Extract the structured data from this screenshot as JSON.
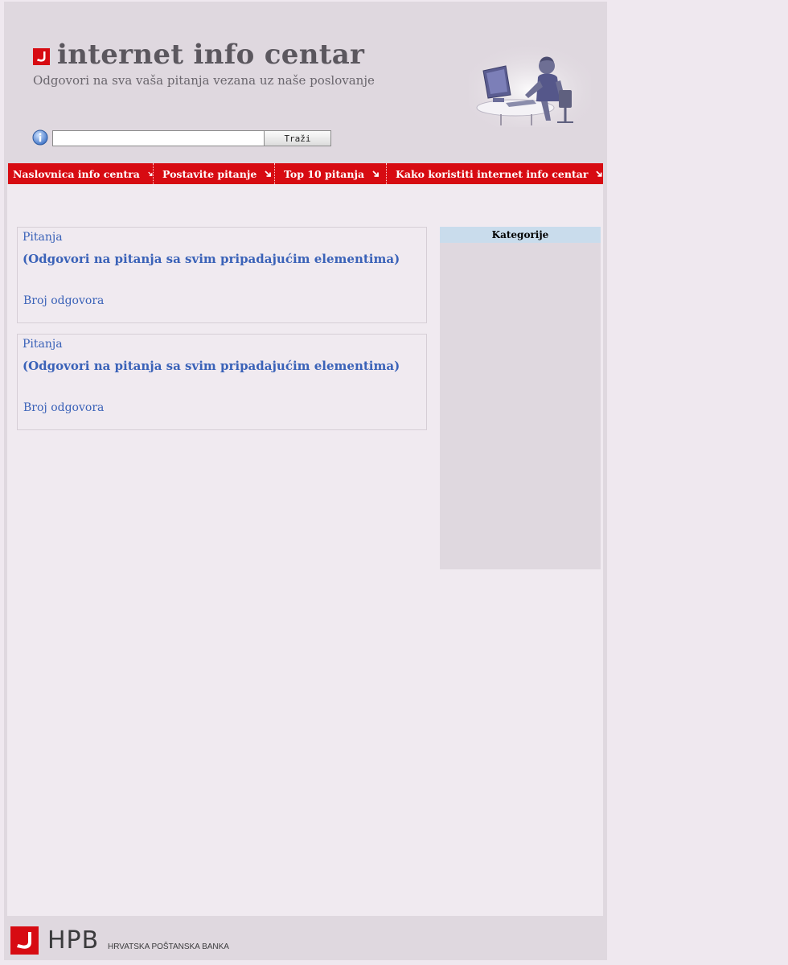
{
  "header": {
    "title": "internet info centar",
    "subtitle": "Odgovori na sva vaša pitanja vezana uz naše poslovanje"
  },
  "search": {
    "value": "",
    "button_label": "Traži"
  },
  "nav": {
    "items": [
      {
        "label": "Naslovnica info centra"
      },
      {
        "label": "Postavite pitanje"
      },
      {
        "label": "Top 10 pitanja"
      },
      {
        "label": "Kako koristiti internet info centar"
      }
    ]
  },
  "main": {
    "cards": [
      {
        "heading": "Pitanja",
        "question": "(Odgovori na pitanja sa svim pripadajućim elementima)",
        "count_label": "Broj odgovora"
      },
      {
        "heading": "Pitanja",
        "question": "(Odgovori na pitanja sa svim pripadajućim elementima)",
        "count_label": "Broj odgovora"
      }
    ]
  },
  "sidebar": {
    "title": "Kategorije"
  },
  "footer": {
    "brand": "HPB",
    "bank_name": "HRVATSKA POŠTANSKA BANKA"
  },
  "colors": {
    "accent": "#d70b12",
    "link": "#3a62b8",
    "panel": "#dfd8df",
    "background": "#efe8ef"
  },
  "icons": {
    "logo": "hpb-logo-icon",
    "info": "info-icon",
    "nav_arrow": "arrow-down-right-icon",
    "photo": "support-agent-photo"
  }
}
